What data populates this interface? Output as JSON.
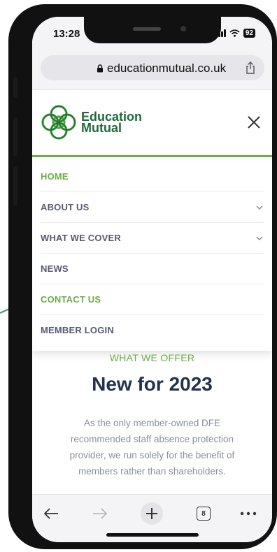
{
  "status": {
    "time": "13:28",
    "battery": "92"
  },
  "browser": {
    "url": "educationmutual.co.uk",
    "tab_count": "8"
  },
  "site": {
    "logo_line1": "Education",
    "logo_line2": "Mutual"
  },
  "menu": {
    "items": [
      {
        "label": "HOME"
      },
      {
        "label": "ABOUT US"
      },
      {
        "label": "WHAT WE COVER"
      },
      {
        "label": "NEWS"
      },
      {
        "label": "CONTACT US"
      },
      {
        "label": "MEMBER LOGIN"
      }
    ]
  },
  "content": {
    "eyebrow": "WHAT WE OFFER",
    "headline": "New for 2023",
    "body": "As the only member-owned DFE recommended staff absence protection provider, we run solely for the benefit of members rather than shareholders."
  },
  "colors": {
    "brand_green": "#6bae45",
    "brand_dark_green": "#1e6a3a",
    "heading_navy": "#22344a"
  }
}
